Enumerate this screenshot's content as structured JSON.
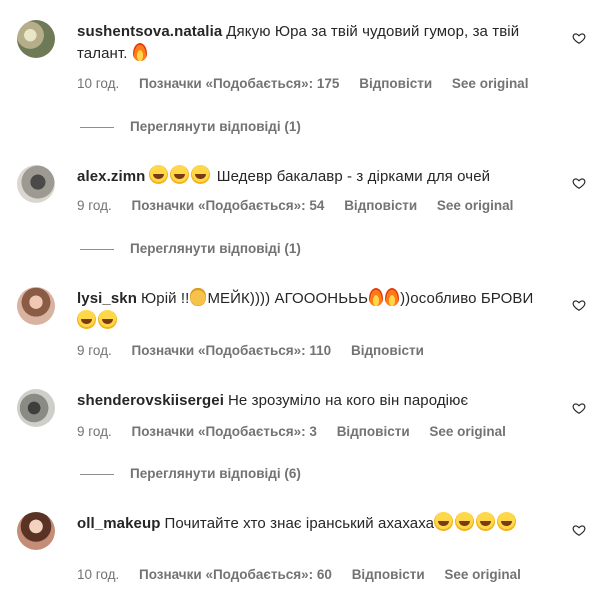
{
  "comments": [
    {
      "username": "sushentsova.natalia",
      "text": "Дякую Юра за твій чудовий гумор, за твій талант.",
      "time": "10 год.",
      "likes": "Позначки «Подобається»: 175",
      "reply": "Відповісти",
      "see_original": "See original",
      "view_replies": "Переглянути відповіді (1)"
    },
    {
      "username": "alex.zimn",
      "text": "Шедевр бакалавр - з дірками для очей",
      "time": "9 год.",
      "likes": "Позначки «Подобається»: 54",
      "reply": "Відповісти",
      "see_original": "See original",
      "view_replies": "Переглянути відповіді (1)"
    },
    {
      "username": "lysi_skn",
      "text_a": "Юрій !!",
      "text_b": "МЕЙК)))) АГОООНЬЬЬ",
      "text_c": "))особливо БРОВИ",
      "time": "9 год.",
      "likes": "Позначки «Подобається»: 110",
      "reply": "Відповісти"
    },
    {
      "username": "shenderovskiisergei",
      "text": "Не зрозуміло на кого він пародіює",
      "time": "9 год.",
      "likes": "Позначки «Подобається»: 3",
      "reply": "Відповісти",
      "see_original": "See original",
      "view_replies": "Переглянути відповіді (6)"
    },
    {
      "username": "oll_makeup",
      "text": "Почитайте хто знає іранський ахахаха",
      "time": "10 год.",
      "likes": "Позначки «Подобається»: 60",
      "reply": "Відповісти",
      "see_original": "See original"
    }
  ]
}
